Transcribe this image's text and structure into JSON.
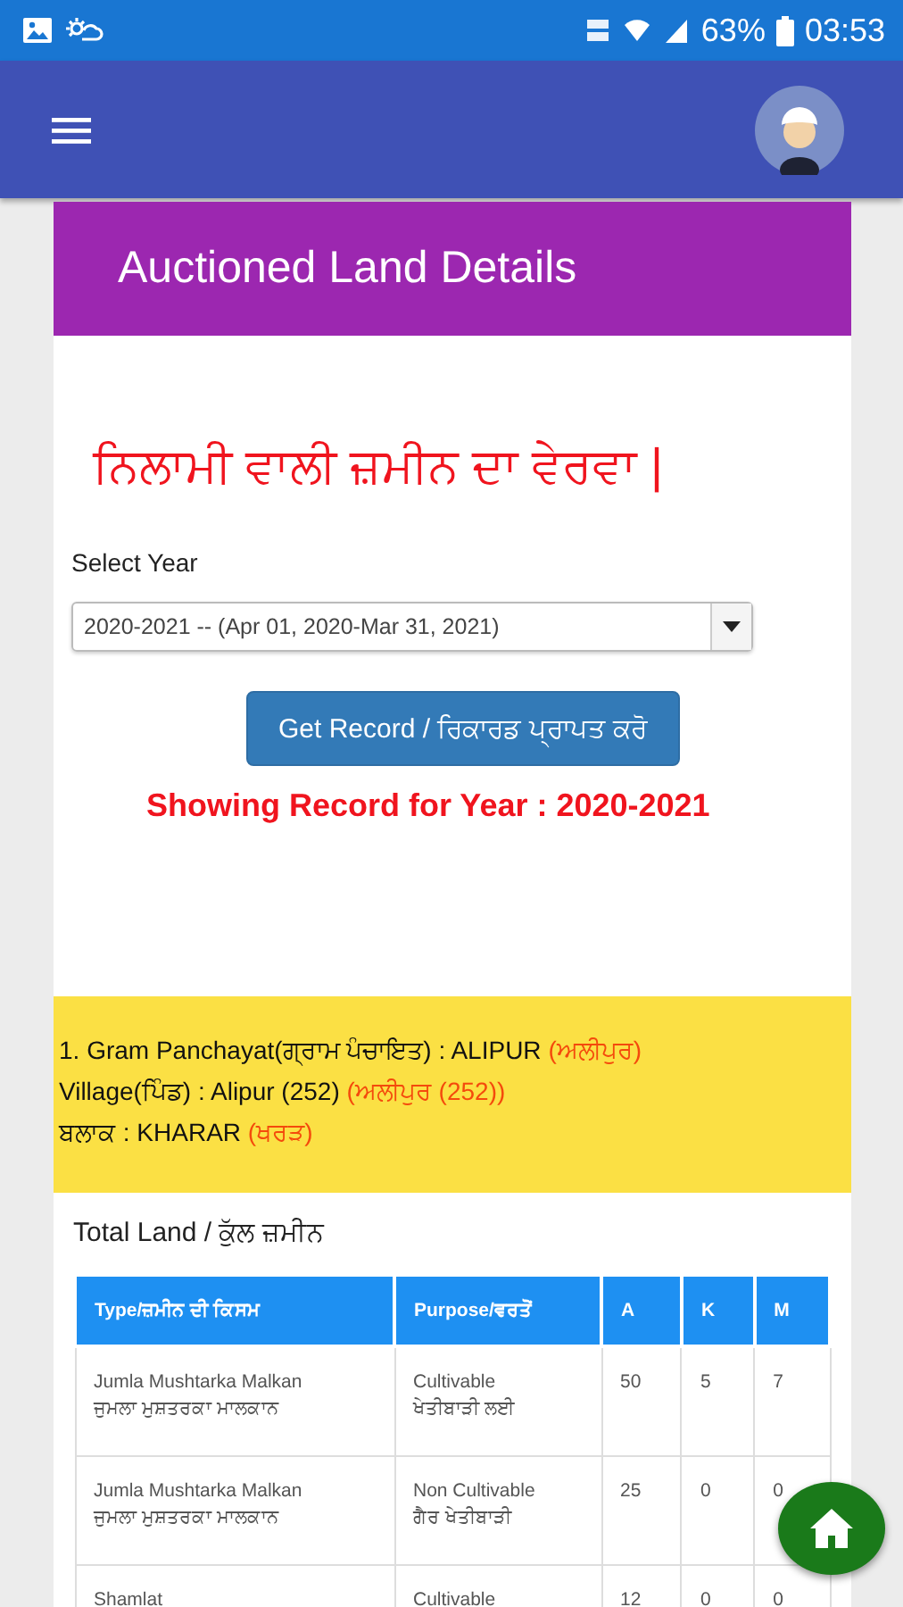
{
  "status_bar": {
    "battery": "63%",
    "time": "03:53"
  },
  "page": {
    "title": "Auctioned Land Details",
    "heading": "ਨਿਲਾਮੀ ਵਾਲੀ ਜ਼ਮੀਨ ਦਾ ਵੇਰਵਾ |",
    "year_label": "Select Year",
    "year_value": "2020-2021  --  (Apr 01, 2020-Mar 31, 2021)",
    "button": "Get Record / ਰਿਕਾਰਡ ਪ੍ਰਾਪਤ ਕਰੋ",
    "showing": "Showing Record for Year : 2020-2021"
  },
  "info": [
    {
      "parts": [
        {
          "text": "1. Gram Panchayat(ਗ੍ਰਾਮ ਪੰਚਾਇਤ) : ALIPUR ",
          "accent": false
        },
        {
          "text": "(ਅਲੀਪੁਰ)",
          "accent": true
        }
      ]
    },
    {
      "parts": [
        {
          "text": "Village(ਪਿੰਡ) : Alipur (252) ",
          "accent": false
        },
        {
          "text": "(ਅਲੀਪੁਰ (252))",
          "accent": true
        }
      ]
    },
    {
      "parts": [
        {
          "text": "ਬਲਾਕ : KHARAR ",
          "accent": false
        },
        {
          "text": "(ਖਰੜ)",
          "accent": true
        }
      ]
    }
  ],
  "total_land": {
    "title": "Total Land / ਕੁੱਲ ਜ਼ਮੀਨ",
    "columns": [
      "Type/ਜ਼ਮੀਨ ਦੀ ਕਿਸਮ",
      "Purpose/ਵਰਤੋਂ",
      "A",
      "K",
      "M"
    ],
    "rows": [
      {
        "type": [
          "Jumla Mushtarka Malkan",
          "ਜੁਮਲਾ ਮੁਸ਼ਤਰਕਾ ਮਾਲਕਾਨ"
        ],
        "purpose": [
          "Cultivable",
          "ਖੇਤੀਬਾੜੀ ਲਈ"
        ],
        "a": "50",
        "k": "5",
        "m": "7"
      },
      {
        "type": [
          "Jumla Mushtarka Malkan",
          "ਜੁਮਲਾ ਮੁਸ਼ਤਰਕਾ ਮਾਲਕਾਨ"
        ],
        "purpose": [
          "Non Cultivable",
          "ਗੈਰ ਖੇਤੀਬਾੜੀ"
        ],
        "a": "25",
        "k": "0",
        "m": "0"
      },
      {
        "type": [
          "Shamlat"
        ],
        "purpose": [
          "Cultivable"
        ],
        "a": "12",
        "k": "0",
        "m": "0"
      }
    ]
  }
}
